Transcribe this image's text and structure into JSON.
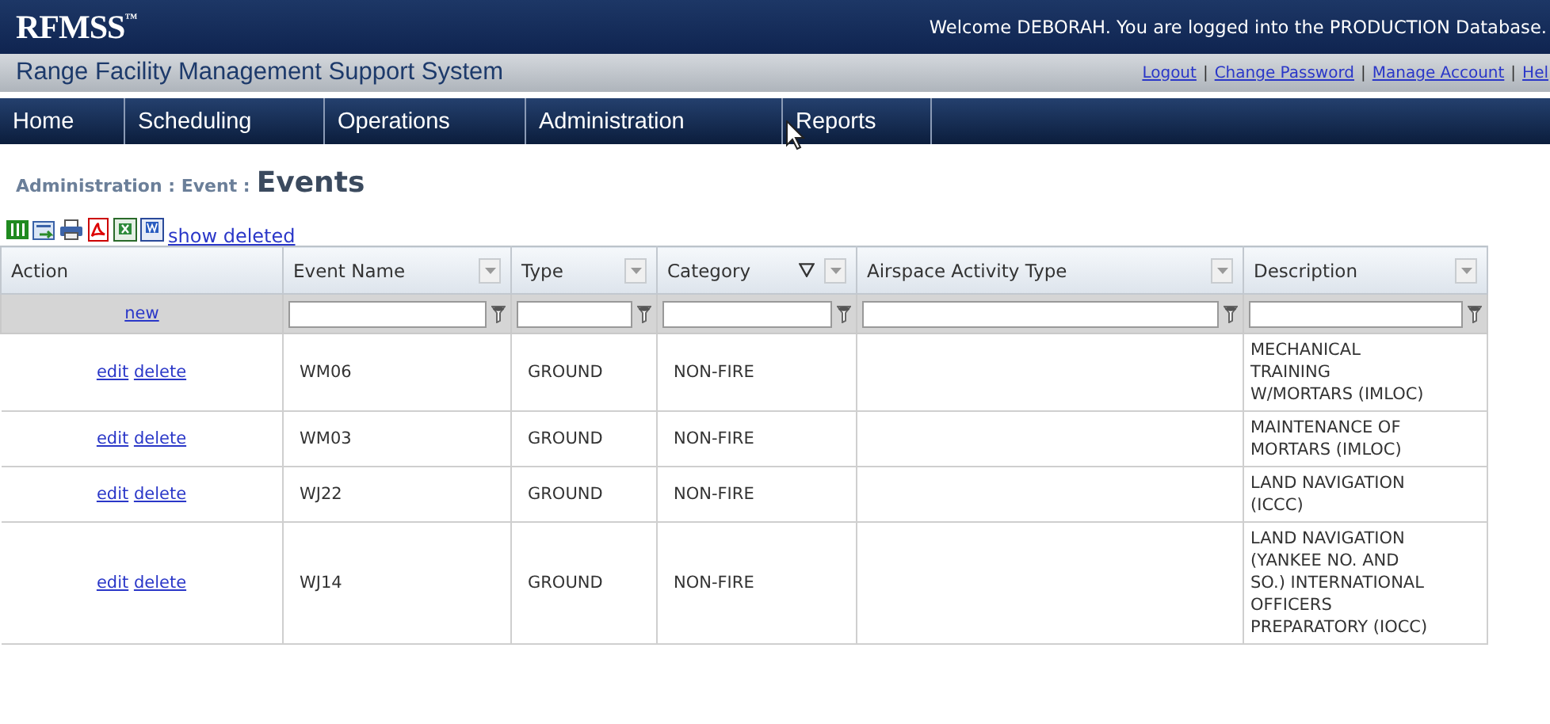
{
  "header": {
    "logo": "RFMSS",
    "logo_mark": "™",
    "welcome": "Welcome DEBORAH. You are logged into the PRODUCTION Database."
  },
  "subheader": {
    "title": "Range Facility Management Support System",
    "links": [
      {
        "kind": "link",
        "text": "Logout"
      },
      {
        "kind": "separator",
        "text": "|"
      },
      {
        "kind": "link",
        "text": "Change Password"
      },
      {
        "kind": "separator",
        "text": "|"
      },
      {
        "kind": "link",
        "text": "Manage Account"
      },
      {
        "kind": "separator",
        "text": "|"
      },
      {
        "kind": "link",
        "text": "Hel"
      }
    ]
  },
  "nav": {
    "items": [
      "Home",
      "Scheduling",
      "Operations",
      "Administration",
      "Reports"
    ]
  },
  "breadcrumb": {
    "path": "Administration : Event :",
    "title": "Events"
  },
  "toolbar": {
    "show_deleted": "show deleted"
  },
  "table": {
    "columns": [
      {
        "label": "Action",
        "kind": "plain",
        "sorted": false
      },
      {
        "label": "Event Name",
        "kind": "menu",
        "sorted": false
      },
      {
        "label": "Type",
        "kind": "menu",
        "sorted": false
      },
      {
        "label": "Category",
        "kind": "menu",
        "sorted": true
      },
      {
        "label": "Airspace Activity Type",
        "kind": "menu",
        "sorted": false
      },
      {
        "label": "Description",
        "kind": "menu",
        "sorted": false
      }
    ],
    "new_link": "new",
    "rows": [
      {
        "cells": [
          [
            "edit",
            "delete"
          ],
          "WM06",
          "GROUND",
          "NON-FIRE",
          "",
          "MECHANICAL TRAINING W/MORTARS (IMLOC)"
        ]
      },
      {
        "cells": [
          [
            "edit",
            "delete"
          ],
          "WM03",
          "GROUND",
          "NON-FIRE",
          "",
          "MAINTENANCE OF MORTARS (IMLOC)"
        ]
      },
      {
        "cells": [
          [
            "edit",
            "delete"
          ],
          "WJ22",
          "GROUND",
          "NON-FIRE",
          "",
          "LAND NAVIGATION (ICCC)"
        ]
      },
      {
        "cells": [
          [
            "edit",
            "delete"
          ],
          "WJ14",
          "GROUND",
          "NON-FIRE",
          "",
          "LAND NAVIGATION (YANKEE NO. AND SO.) INTERNATIONAL OFFICERS PREPARATORY (IOCC)"
        ]
      }
    ]
  }
}
